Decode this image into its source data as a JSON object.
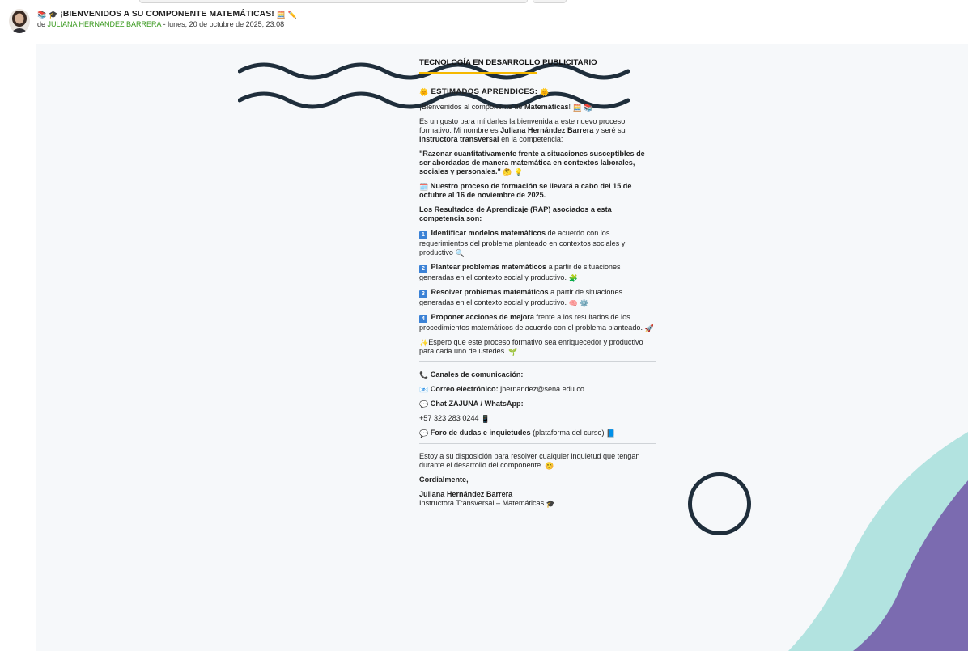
{
  "header": {
    "subject_prefix_icons": [
      "books-icon",
      "graduation-cap-icon"
    ],
    "subject": "¡BIENVENIDOS A SU COMPONENTE MATEMÁTICAS!",
    "subject_suffix_icons": [
      "abacus-icon",
      "pencil-icon"
    ],
    "by_prefix": "de",
    "author": "JULIANA HERNANDEZ BARRERA",
    "date_text": " - lunes, 20 de octubre de 2025, 23:08"
  },
  "article": {
    "title": "TECNOLOGÍA EN DESARROLLO PUBLICITARIO",
    "greeting": "ESTIMADOS APRENDICES:",
    "welcome_pre": "¡Bienvenidos al componente de ",
    "welcome_bold": "Matemáticas",
    "welcome_post": "!",
    "intro_1": "Es un gusto para mí darles la bienvenida a este nuevo proceso formativo. Mi nombre es ",
    "intro_name": "Juliana Hernández Barrera",
    "intro_2": " y seré su ",
    "intro_role": "instructora transversal",
    "intro_3": " en la competencia:",
    "competencia": "\"Razonar cuantitativamente frente a situaciones susceptibles de ser abordadas de manera matemática en contextos laborales, sociales y personales.\"",
    "schedule": "Nuestro proceso de formación se llevará a cabo del 15 de octubre al 16 de noviembre de 2025.",
    "rap_intro": "Los Resultados de Aprendizaje (RAP) asociados a esta competencia son:",
    "raps": [
      {
        "num": "1",
        "bold": "Identificar modelos matemáticos",
        "text": " de acuerdo con los requerimientos del problema planteado en contextos sociales y productivo"
      },
      {
        "num": "2",
        "bold": "Plantear problemas matemáticos",
        "text": " a partir de situaciones generadas en el contexto social y productivo."
      },
      {
        "num": "3",
        "bold": "Resolver problemas matemáticos",
        "text": " a partir de situaciones generadas en el contexto social y productivo."
      },
      {
        "num": "4",
        "bold": "Proponer acciones de mejora",
        "text": " frente a los resultados de los procedimientos matemáticos de acuerdo con el problema planteado."
      }
    ],
    "closing_wish": "Espero que este proceso formativo sea enriquecedor y productivo para cada uno de ustedes.",
    "channels_title": "Canales de comunicación:",
    "email_label": "Correo electrónico:",
    "email_value": " jhernandez@sena.edu.co",
    "chat_label": "Chat ZAJUNA / WhatsApp:",
    "phone": "+57 323 283 0244",
    "forum_label": "Foro de dudas e inquietudes",
    "forum_note": " (plataforma del curso)",
    "availability": "Estoy a su disposición para resolver cualquier inquietud que tengan durante el desarrollo del componente.",
    "regards": "Cordialmente,",
    "signature_name": "Juliana Hernández Barrera",
    "signature_role": "Instructora Transversal – Matemáticas"
  },
  "colors": {
    "author_green": "#3a9a1f",
    "title_underline": "#f5b800",
    "wave": "#1f2e3b",
    "teal_shape": "#b2e3e0",
    "purple_shape": "#7b6bb0",
    "content_bg": "#f6f8fa"
  }
}
